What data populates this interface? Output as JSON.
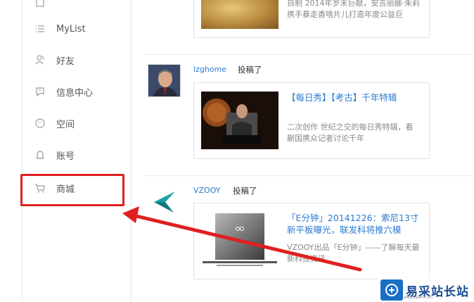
{
  "sidebar": {
    "items": [
      {
        "label": "",
        "icon": "partial-icon"
      },
      {
        "label": "MyList",
        "icon": "list-icon"
      },
      {
        "label": "好友",
        "icon": "friends-icon"
      },
      {
        "label": "信息中心",
        "icon": "message-icon"
      },
      {
        "label": "空间",
        "icon": "space-icon"
      },
      {
        "label": "账号",
        "icon": "account-icon"
      },
      {
        "label": "商城",
        "icon": "cart-icon"
      }
    ]
  },
  "feed": {
    "posts": [
      {
        "card_desc": "自制 2014年岁末巨献，安吉丽娜·朱莉携手暴走香啥片儿打造年度公益巨"
      },
      {
        "author": "lzghome",
        "action": "投稿了",
        "card_title": "【每日秀】【考古】千年特辑",
        "card_desc": "二次创作 世纪之交的每日秀特辑，看 蒯国携众记者讨论千年"
      },
      {
        "author": "VZOOY",
        "action": "投稿了",
        "card_title": "「E分钟」20141226：索尼13寸新平板曝光，联发科将推六模",
        "card_desc": "VZOOY出品「E分钟」——了解每天最新科技资讯"
      }
    ]
  },
  "watermark": {
    "logo_text": "易采站长站",
    "logo_sub": "www.Easck.Com"
  },
  "colors": {
    "accent_link": "#2b7bd0",
    "highlight": "#e02020",
    "logo_blue": "#1a6fc4"
  }
}
